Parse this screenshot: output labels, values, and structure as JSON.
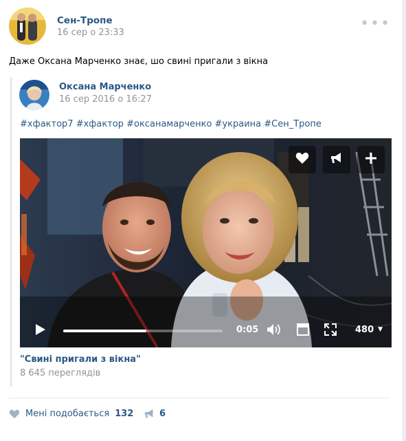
{
  "post": {
    "author": "Сен-Тропе",
    "date": "16 сер о 23:33",
    "text": "Даже Оксана Марченко знає, шо свині пригали з вікна"
  },
  "repost": {
    "author": "Оксана Марченко",
    "date": "16 сер 2016 о 16:27",
    "tags": "#хфактор7 #хфактор #оксанамарченко #украина #Сен_Тропе"
  },
  "video": {
    "title": "\"Свині пригали з вікна\"",
    "views": "8 645 переглядів",
    "time": "0:05",
    "quality": "480",
    "progress": 0.52,
    "actions": [
      "heart-icon",
      "megaphone-icon",
      "plus-icon"
    ]
  },
  "footer": {
    "like_label": "Мені подобається",
    "like_count": "132",
    "share_count": "6"
  },
  "colors": {
    "link": "#2a5885",
    "muted": "#939393",
    "background": "#edeef0"
  }
}
